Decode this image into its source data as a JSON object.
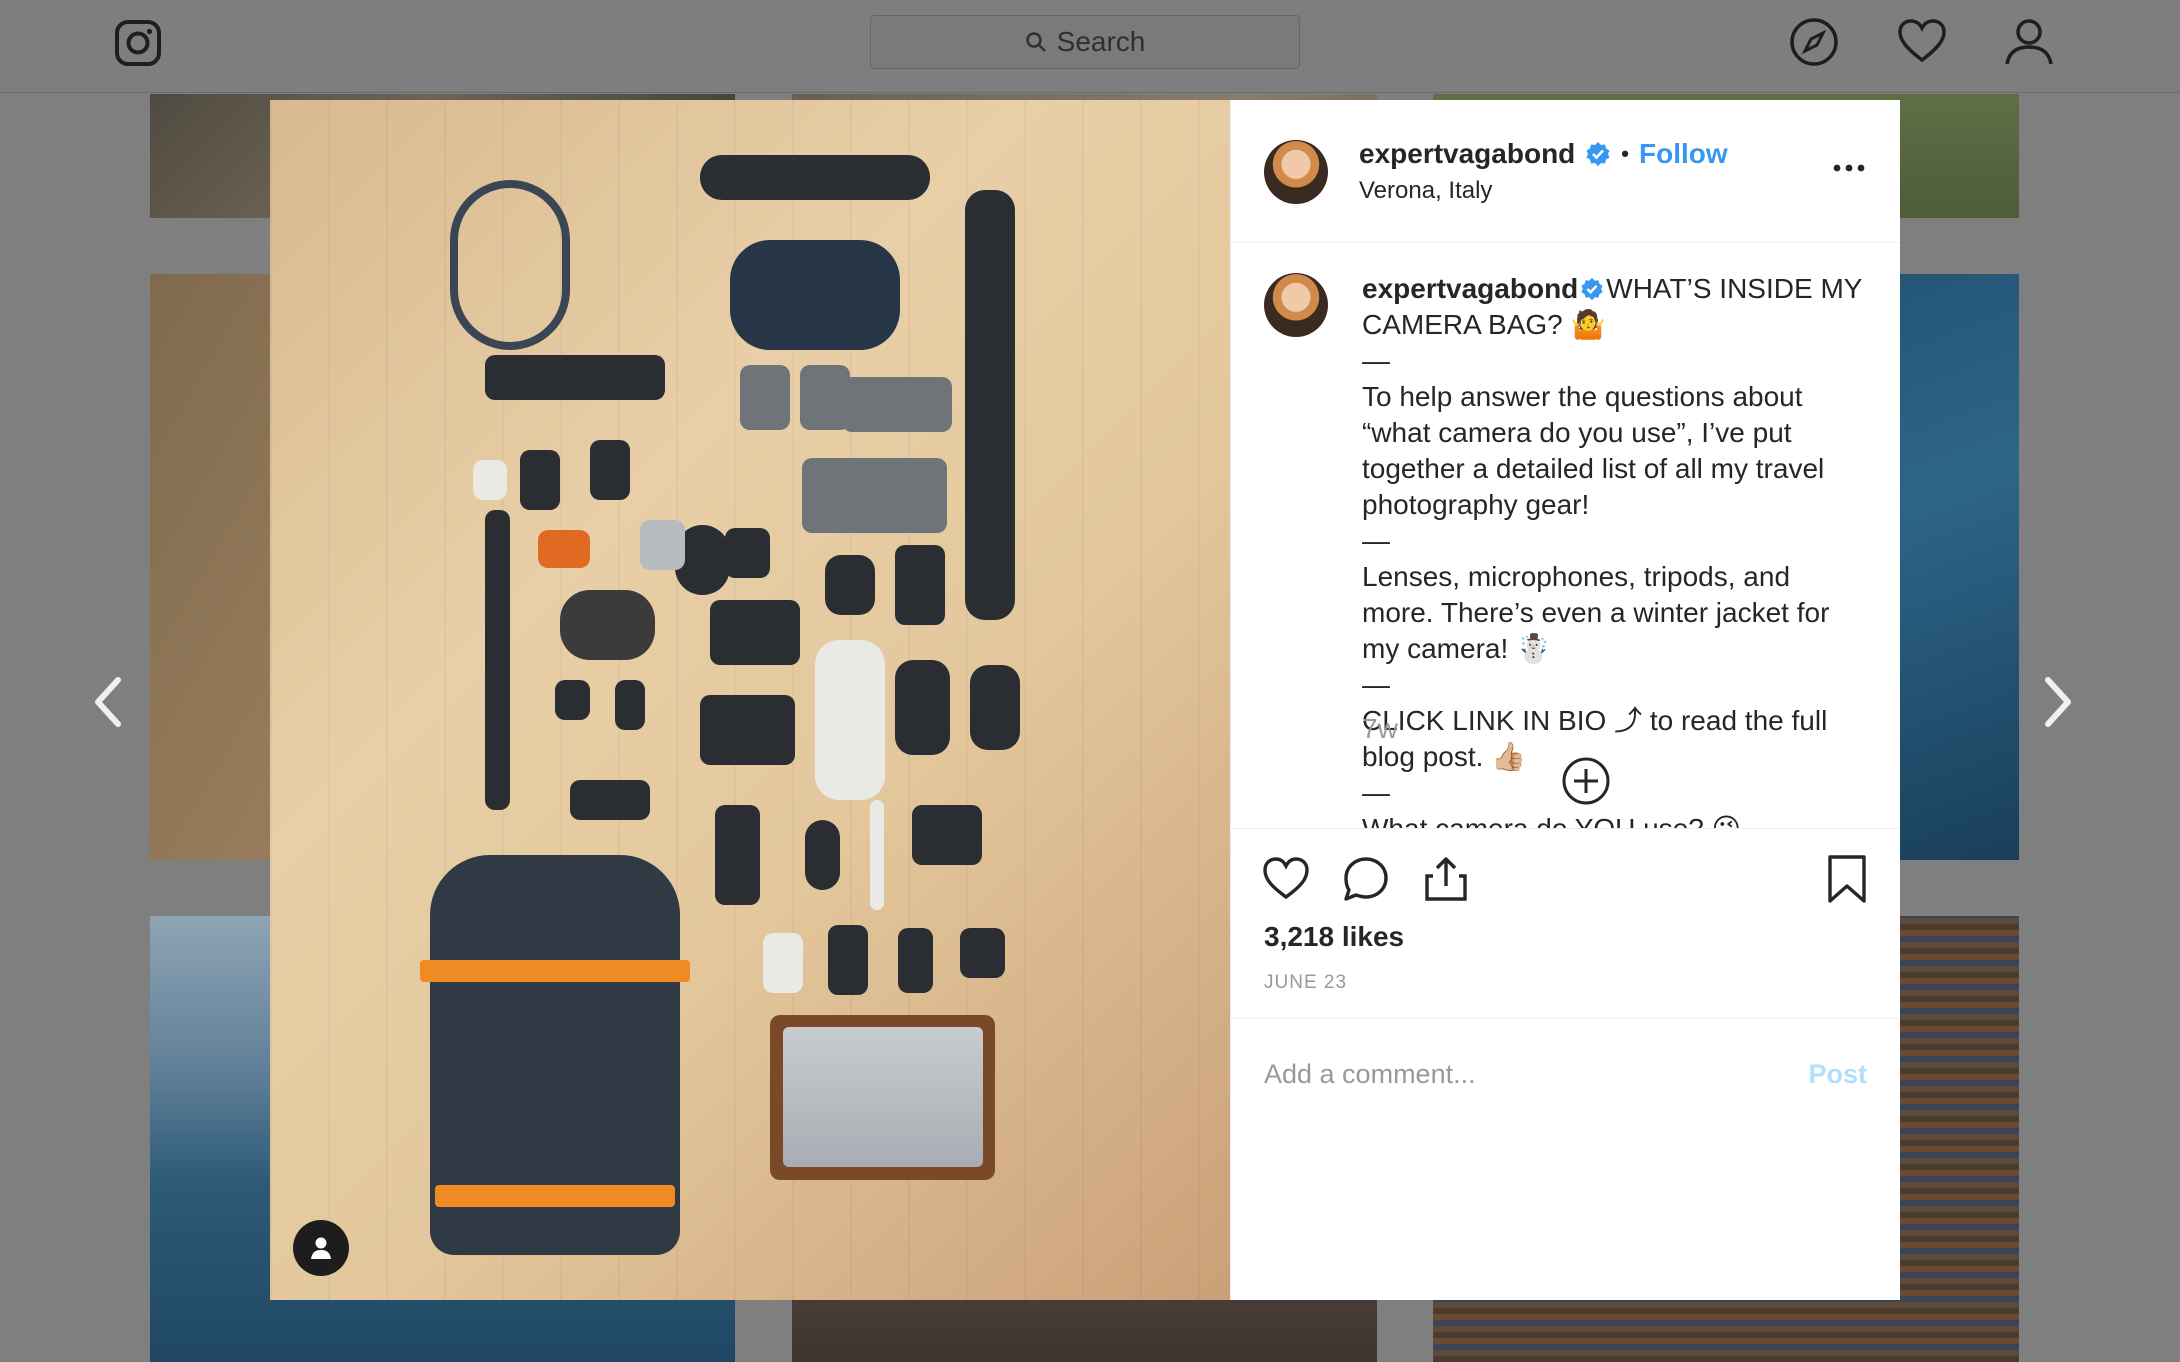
{
  "topbar": {
    "logo_icon": "instagram-logo-icon",
    "search_placeholder": "Search",
    "nav": [
      {
        "icon": "compass-icon"
      },
      {
        "icon": "heart-icon"
      },
      {
        "icon": "profile-icon"
      }
    ]
  },
  "modal": {
    "photo": {
      "tag_icon": "user-tag-icon"
    },
    "header": {
      "username": "expertvagabond",
      "verified": true,
      "separator": "•",
      "follow_label": "Follow",
      "location": "Verona, Italy",
      "more_icon": "more-options-icon"
    },
    "caption": {
      "username": "expertvagabond",
      "lines": [
        "WHAT’S INSIDE MY CAMERA BAG? 🤷",
        "—",
        "To help answer the questions about “what camera do you use”, I’ve put together a detailed list of all my travel photography gear!",
        "—",
        "Lenses, microphones, tripods, and more. There’s even a winter jacket for my camera! ☃️",
        "—",
        "CLICK LINK IN BIO ⤴ to read the full blog post. 👍🏼",
        "—",
        "What camera do YOU use? 😜"
      ],
      "time_ago": "7w",
      "load_more_icon": "plus-circle-icon"
    },
    "actions": {
      "like_icon": "heart-icon",
      "comment_icon": "comment-icon",
      "share_icon": "share-icon",
      "save_icon": "bookmark-icon",
      "likes": "3,218 likes",
      "date": "JUNE 23"
    },
    "comment_form": {
      "placeholder": "Add a comment...",
      "post_label": "Post"
    }
  },
  "navigation": {
    "prev_icon": "chevron-left-icon",
    "next_icon": "chevron-right-icon"
  },
  "colors": {
    "link_blue": "#3897f0",
    "post_disabled": "#b2dffc",
    "overlay": "#7f7f7f",
    "secondary_text": "#999999"
  }
}
